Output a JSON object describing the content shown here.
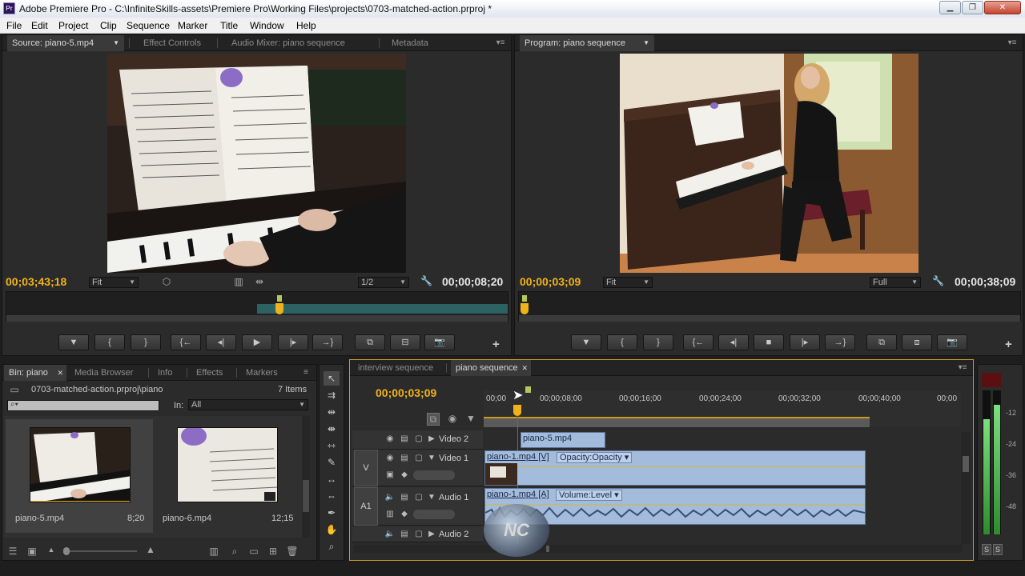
{
  "window": {
    "title": "Adobe Premiere Pro - C:\\InfiniteSkills-assets\\Premiere Pro\\Working Files\\projects\\0703-matched-action.prproj *",
    "app_icon": "Pr"
  },
  "menu": [
    "File",
    "Edit",
    "Project",
    "Clip",
    "Sequence",
    "Marker",
    "Title",
    "Window",
    "Help"
  ],
  "source_panel": {
    "tabs": [
      "Source: piano-5.mp4",
      "Effect Controls",
      "Audio Mixer: piano sequence",
      "Metadata"
    ],
    "timecode": "00;03;43;18",
    "zoom": "Fit",
    "resolution": "1/2",
    "duration": "00;00;08;20"
  },
  "program_panel": {
    "tab": "Program: piano sequence",
    "timecode": "00;00;03;09",
    "zoom": "Fit",
    "resolution": "Full",
    "duration": "00;00;38;09"
  },
  "project_panel": {
    "tabs": [
      "Bin: piano",
      "Media Browser",
      "Info",
      "Effects",
      "Markers"
    ],
    "path": "0703-matched-action.prproj\\piano",
    "item_count": "7 Items",
    "in_label": "In:",
    "in_value": "All",
    "items": [
      {
        "name": "piano-5.mp4",
        "duration": "8;20"
      },
      {
        "name": "piano-6.mp4",
        "duration": "12;15"
      }
    ]
  },
  "timeline": {
    "tabs": [
      "interview sequence",
      "piano sequence"
    ],
    "timecode": "00;00;03;09",
    "ruler": [
      "00;00",
      "00;00;08;00",
      "00;00;16;00",
      "00;00;24;00",
      "00;00;32;00",
      "00;00;40;00",
      "00;00"
    ],
    "tracks": [
      {
        "name": "Video 2"
      },
      {
        "name": "Video 1",
        "target": "V"
      },
      {
        "name": "Audio 1",
        "target": "A1"
      },
      {
        "name": "Audio 2"
      }
    ],
    "clips": {
      "v2": "piano-5.mp4",
      "v1": "piano-1.mp4 [V]",
      "v1_fx": "Opacity:Opacity",
      "a1": "piano-1.mp4 [A]",
      "a1_fx": "Volume:Level"
    }
  },
  "meter": {
    "labels": [
      "-12",
      "-24",
      "-36",
      "-48"
    ],
    "solo": "S",
    "level": 0.8
  },
  "colors": {
    "timecode_yellow": "#f0b21b",
    "clip_blue": "#a4bcdc",
    "panel_bg": "#2b2b2b"
  }
}
